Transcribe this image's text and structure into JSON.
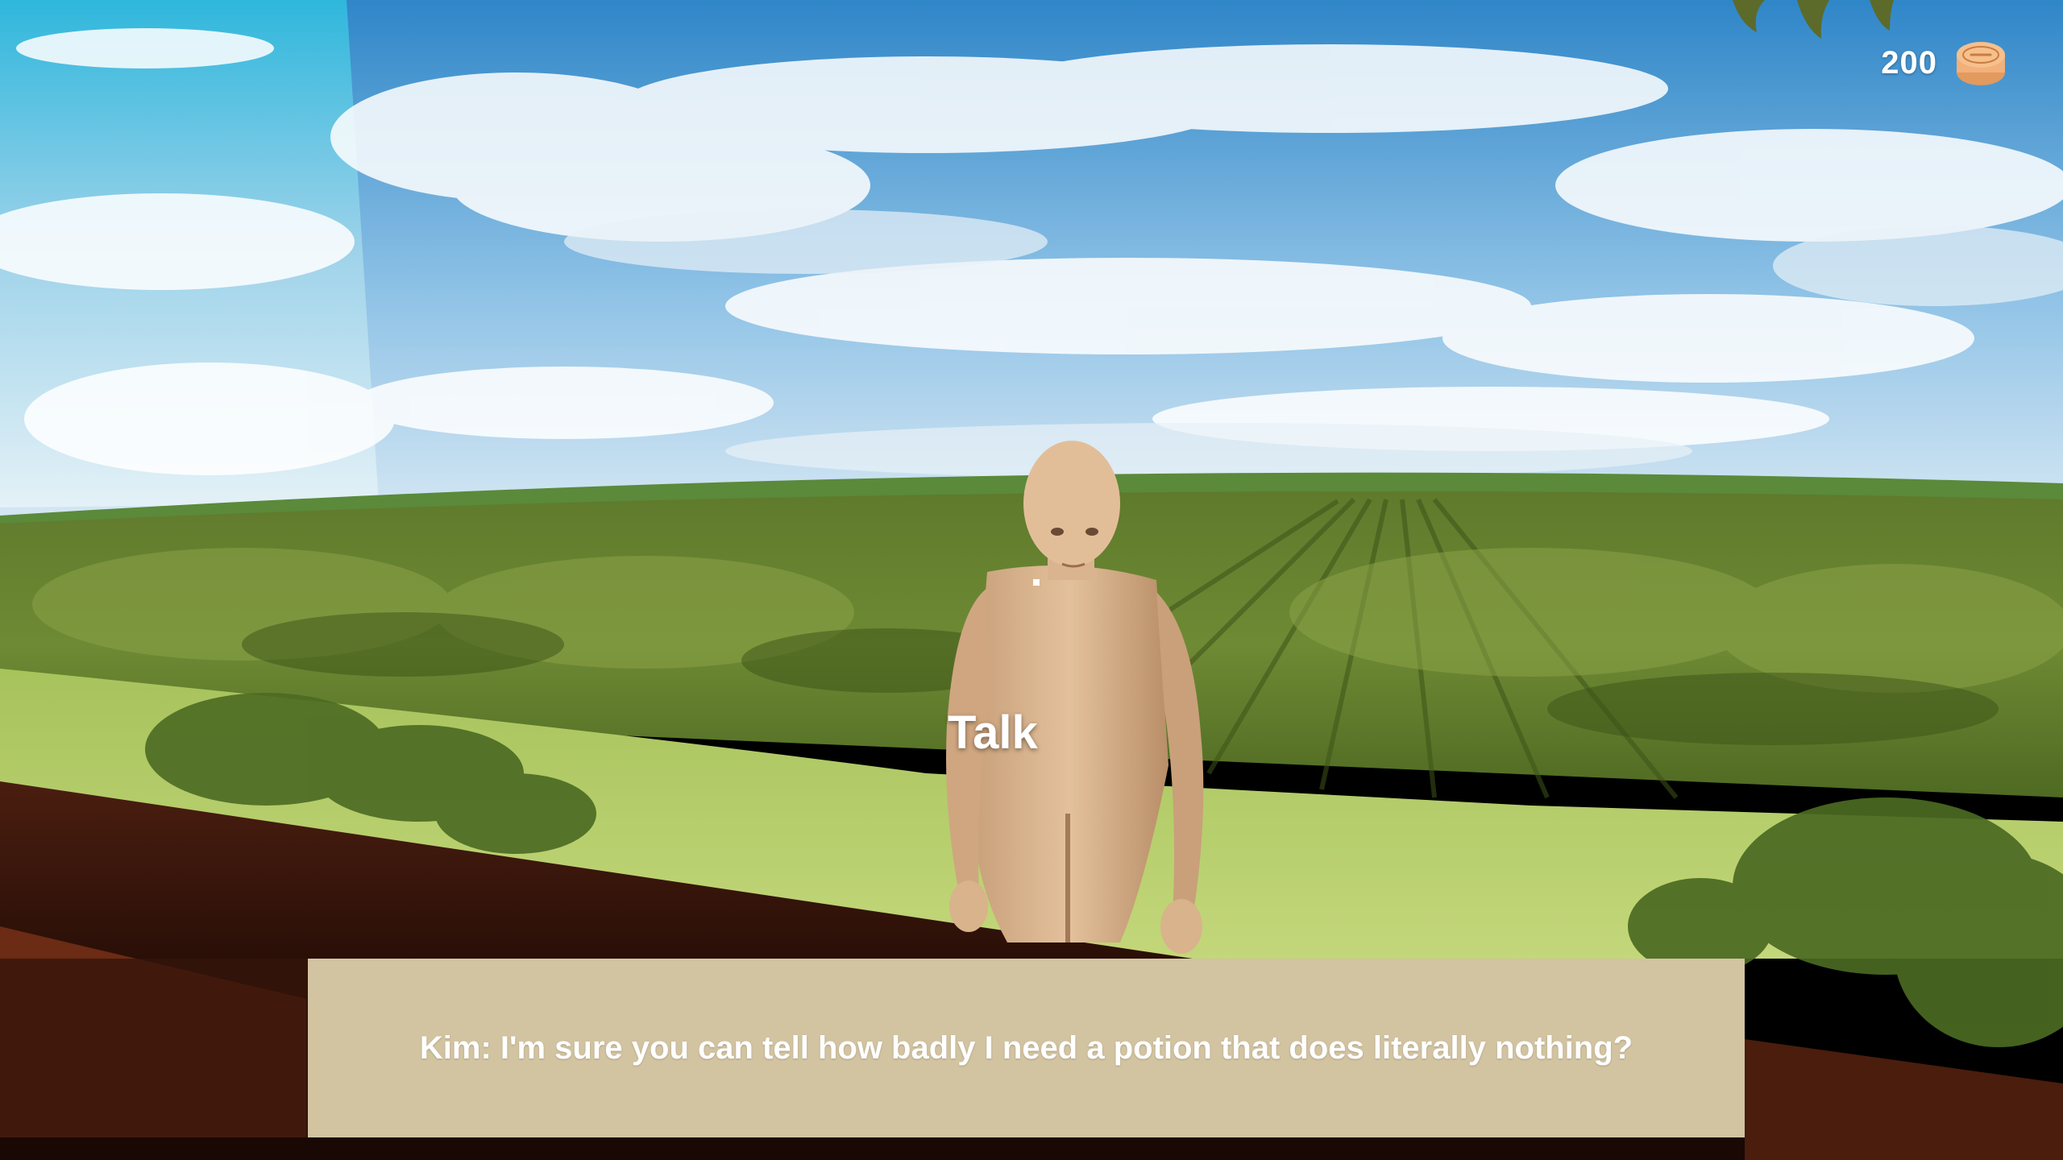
{
  "hud": {
    "coin_count": "200",
    "coin_icon": "coin-stack-icon",
    "coin_color": "#f2b07a"
  },
  "prompt": {
    "label": "Talk"
  },
  "dialogue": {
    "text": "Kim: I'm sure you can tell how badly I need a potion that does literally nothing?",
    "box_color": "#d2c3a1"
  },
  "scene": {
    "npc_name": "Kim"
  }
}
